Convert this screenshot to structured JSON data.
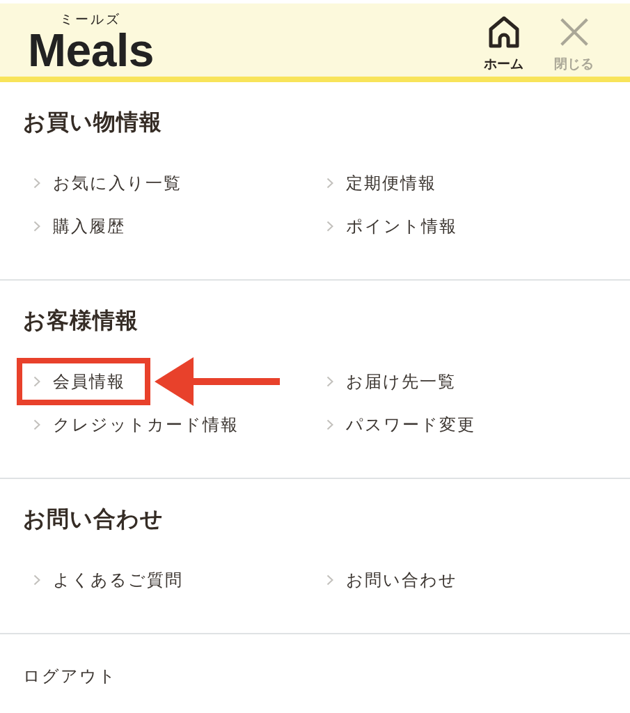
{
  "header": {
    "logo": {
      "reading": "ミールズ",
      "name": "Meals"
    },
    "buttons": [
      {
        "kind": "home",
        "label": "ホーム"
      },
      {
        "kind": "close",
        "label": "閉じる"
      }
    ]
  },
  "sections": [
    {
      "title": "お買い物情報",
      "items": [
        {
          "label": "お気に入り一覧",
          "highlighted": false
        },
        {
          "label": "定期便情報",
          "highlighted": false
        },
        {
          "label": "購入履歴",
          "highlighted": false
        },
        {
          "label": "ポイント情報",
          "highlighted": false
        }
      ]
    },
    {
      "title": "お客様情報",
      "items": [
        {
          "label": "会員情報",
          "highlighted": true
        },
        {
          "label": "お届け先一覧",
          "highlighted": false
        },
        {
          "label": "クレジットカード情報",
          "highlighted": false
        },
        {
          "label": "パスワード変更",
          "highlighted": false
        }
      ]
    },
    {
      "title": "お問い合わせ",
      "items": [
        {
          "label": "よくあるご質問",
          "highlighted": false
        },
        {
          "label": "お問い合わせ",
          "highlighted": false
        }
      ]
    }
  ],
  "logout": {
    "label": "ログアウト"
  }
}
